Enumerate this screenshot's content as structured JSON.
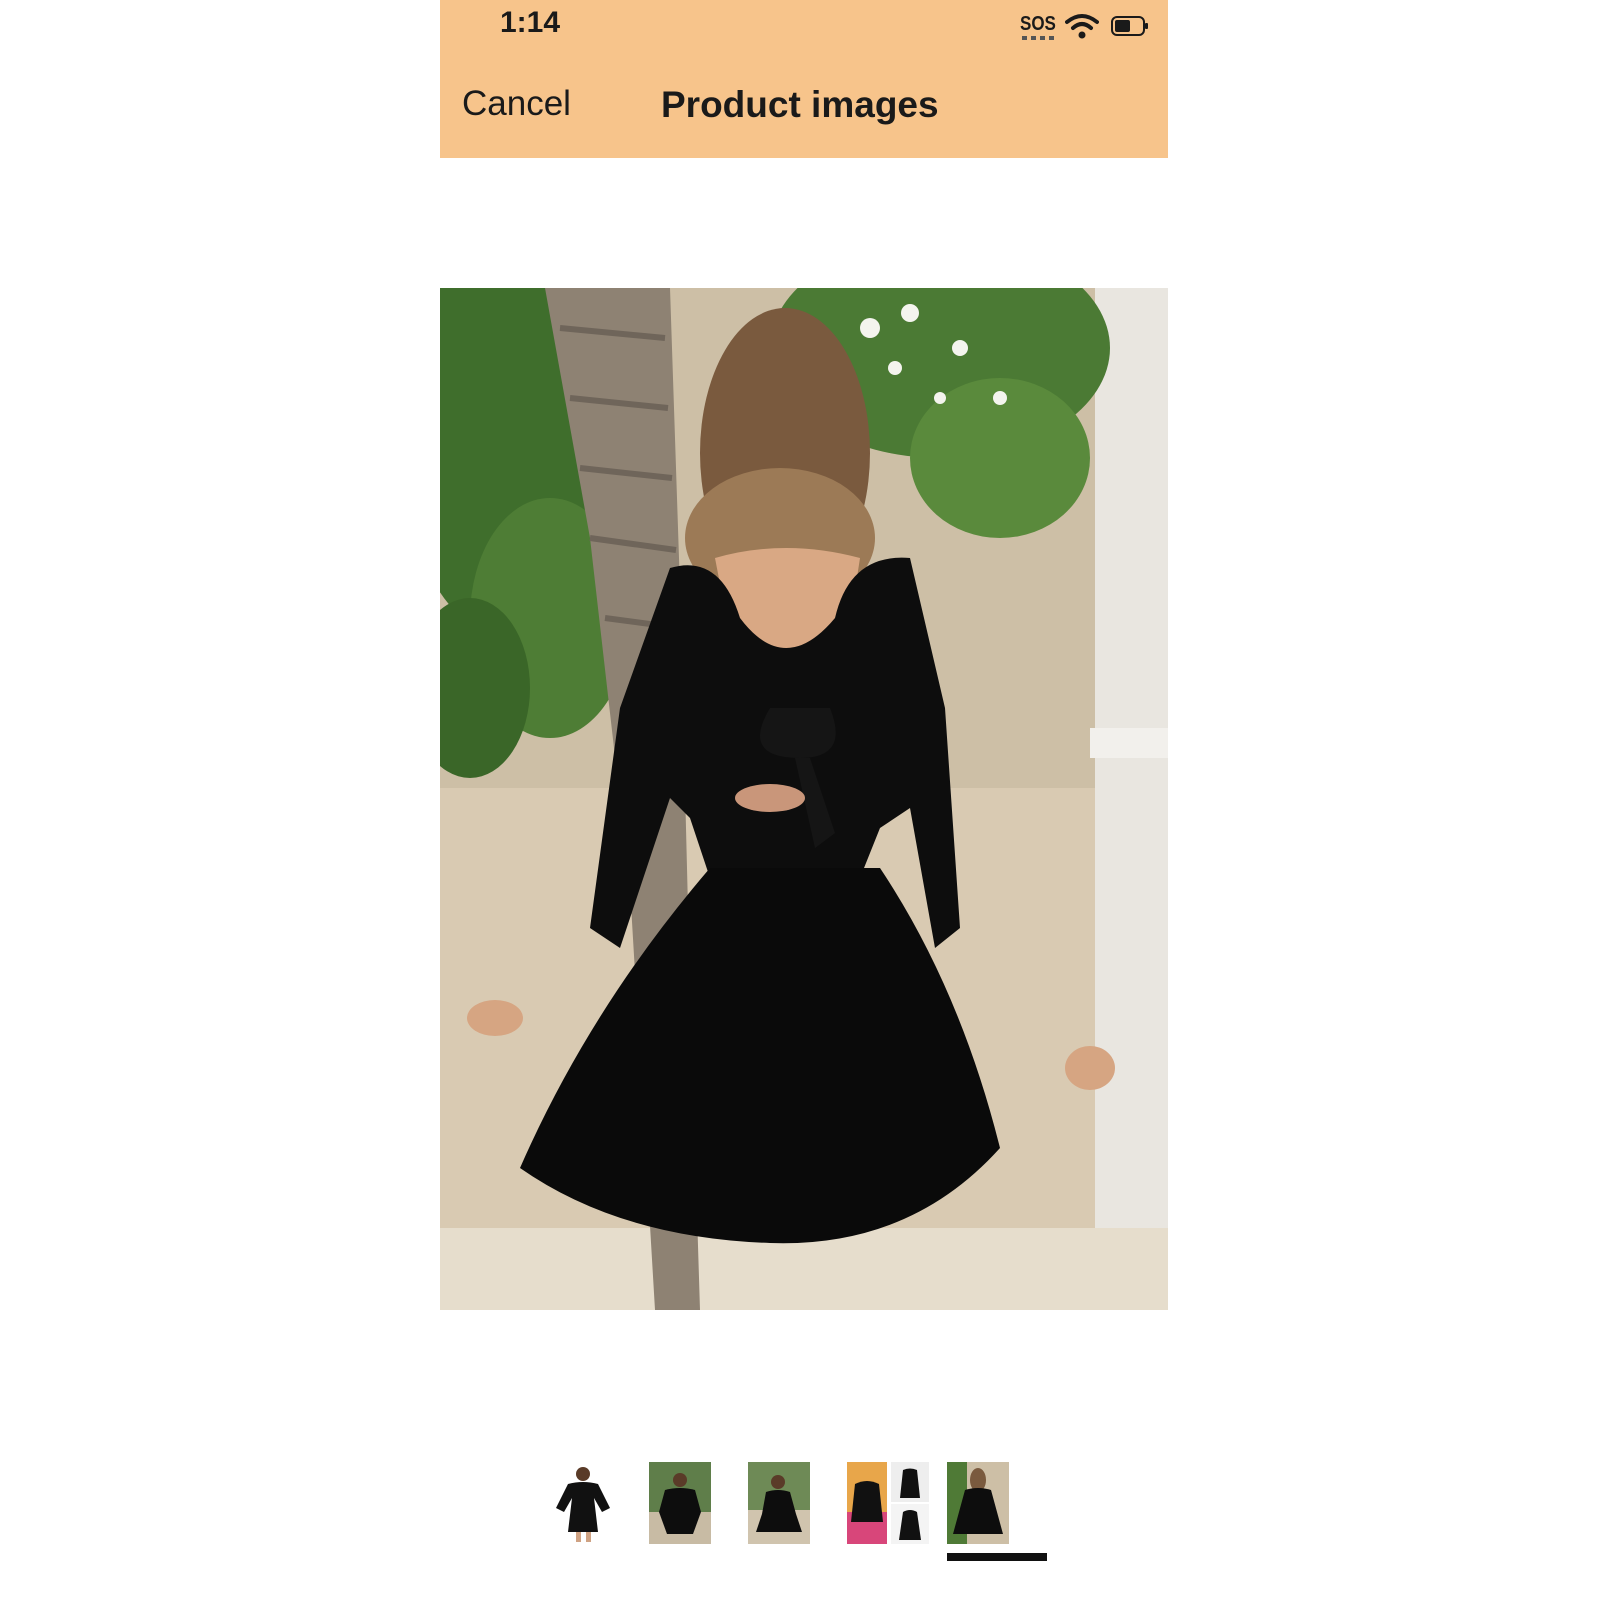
{
  "status_bar": {
    "time": "1:14",
    "sos_label": "SOS",
    "wifi_icon": "wifi-icon",
    "battery_icon": "battery-icon"
  },
  "header": {
    "cancel_label": "Cancel",
    "title": "Product images",
    "background_color": "#f7c48b"
  },
  "gallery": {
    "selected_index": 4,
    "thumbnail_count": 5,
    "main_image": "back view of black long-sleeve dress with tie back, outdoors with greenery and palm tree"
  }
}
